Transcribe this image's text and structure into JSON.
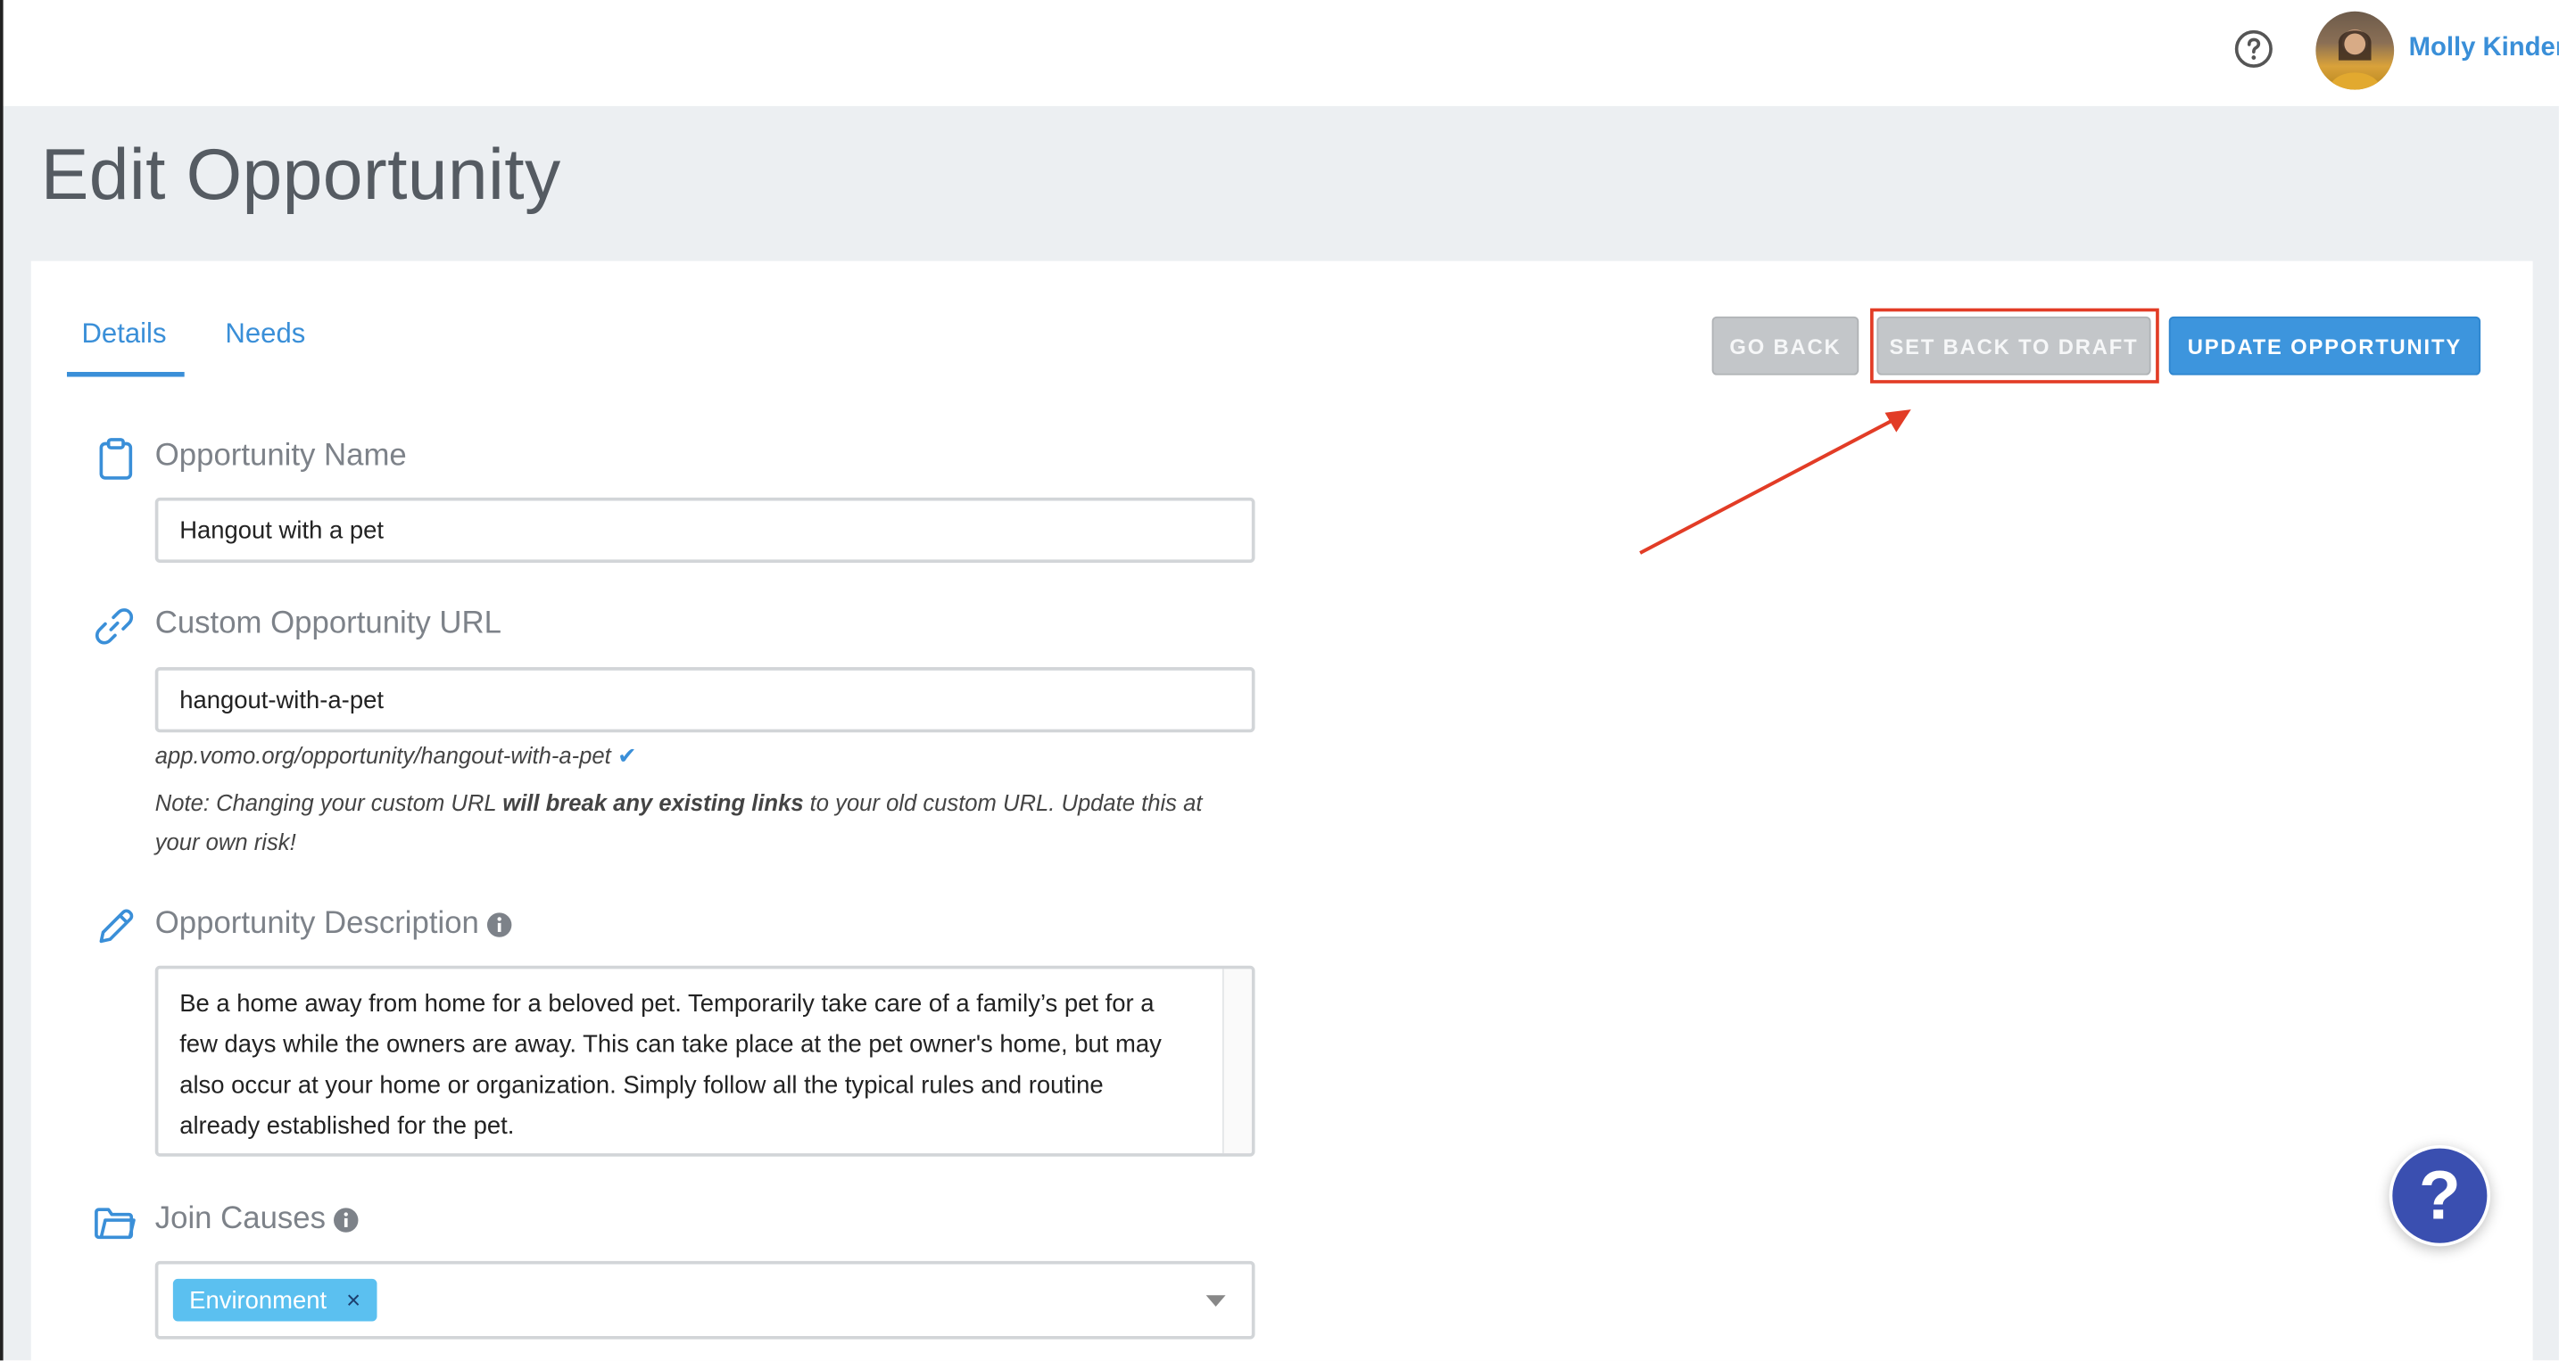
{
  "header": {
    "user_name": "Molly Kinder",
    "help_icon": "question-circle-icon",
    "avatar_icon": "user-avatar"
  },
  "page": {
    "title": "Edit Opportunity"
  },
  "tabs": [
    {
      "label": "Details",
      "active": true
    },
    {
      "label": "Needs",
      "active": false
    }
  ],
  "actions": {
    "go_back": "GO BACK",
    "set_back_to_draft": "SET BACK TO DRAFT",
    "update": "UPDATE OPPORTUNITY"
  },
  "form": {
    "name": {
      "label": "Opportunity Name",
      "value": "Hangout with a pet",
      "icon": "clipboard-icon"
    },
    "url": {
      "label": "Custom Opportunity URL",
      "value": "hangout-with-a-pet",
      "icon": "link-icon",
      "preview": "app.vomo.org/opportunity/hangout-with-a-pet",
      "note_prefix": "Note: Changing your custom URL ",
      "note_bold": "will break any existing links",
      "note_suffix": " to your old custom URL. Update this at your own risk!"
    },
    "description": {
      "label": "Opportunity Description",
      "icon": "pencil-icon",
      "value": "Be a home away from home for a beloved pet. Temporarily take care of a family’s pet for a few days while the owners are away. This can take place at the pet owner's home, but may also occur at your home or organization. Simply follow all the typical rules and routine already established for the pet."
    },
    "causes": {
      "label": "Join Causes",
      "icon": "folder-icon",
      "selected": [
        "Environment"
      ],
      "remove_glyph": "×"
    }
  },
  "help_fab": {
    "label": "?"
  },
  "colors": {
    "accent": "#3a8fd8",
    "update_button": "#3d95dd",
    "annotation_red": "#e23c26",
    "chip": "#5bc0f0",
    "fab": "#3a4fb0"
  }
}
